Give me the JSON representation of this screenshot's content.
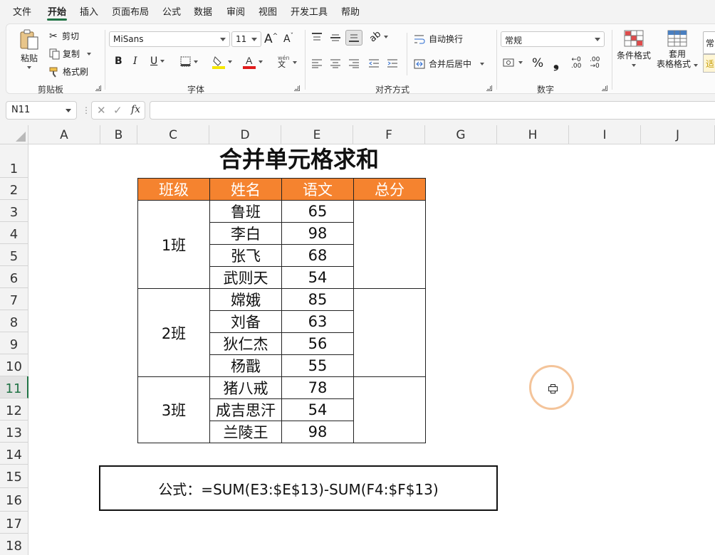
{
  "menu": {
    "file": "文件",
    "home": "开始",
    "insert": "插入",
    "page_layout": "页面布局",
    "formulas": "公式",
    "data": "数据",
    "review": "审阅",
    "view": "视图",
    "developer": "开发工具",
    "help": "帮助"
  },
  "ribbon": {
    "clipboard": {
      "paste": "粘贴",
      "cut": "剪切",
      "copy": "复制",
      "format_painter": "格式刷",
      "label": "剪贴板"
    },
    "font": {
      "family": "MiSans",
      "size": "11",
      "grow": "A",
      "shrink": "A",
      "bold": "B",
      "italic": "I",
      "underline": "U",
      "color_letter": "A",
      "phonetic": "wén",
      "label": "字体"
    },
    "alignment": {
      "wrap_text": "自动换行",
      "merge_center": "合并后居中",
      "label": "对齐方式"
    },
    "number": {
      "format": "常规",
      "percent": "%",
      "comma": "❟",
      "label": "数字"
    },
    "styles": {
      "conditional": "条件格式",
      "format_as_table_1": "套用",
      "format_as_table_2": "表格格式",
      "cell_styles": "常",
      "cell_styles_2": "适"
    },
    "colors": {
      "fill": "#f5e600",
      "font": "#e01b1b"
    }
  },
  "formula_bar": {
    "name_box": "N11",
    "fx": "fx",
    "cancel": "✕",
    "enter": "✓",
    "more": "⋮",
    "value": ""
  },
  "grid": {
    "columns": [
      "A",
      "B",
      "C",
      "D",
      "E",
      "F",
      "G",
      "H",
      "I",
      "J"
    ],
    "rows": [
      "1",
      "2",
      "3",
      "4",
      "5",
      "6",
      "7",
      "8",
      "9",
      "10",
      "11",
      "12",
      "13",
      "14",
      "15",
      "16",
      "17",
      "18"
    ],
    "active_row": "11"
  },
  "sheet": {
    "title": "合并单元格求和",
    "headers": [
      "班级",
      "姓名",
      "语文",
      "总分"
    ],
    "groups": [
      {
        "class": "1班",
        "students": [
          {
            "name": "鲁班",
            "score": "65"
          },
          {
            "name": "李白",
            "score": "98"
          },
          {
            "name": "张飞",
            "score": "68"
          },
          {
            "name": "武则天",
            "score": "54"
          }
        ]
      },
      {
        "class": "2班",
        "students": [
          {
            "name": "嫦娥",
            "score": "85"
          },
          {
            "name": "刘备",
            "score": "63"
          },
          {
            "name": "狄仁杰",
            "score": "56"
          },
          {
            "name": "杨戬",
            "score": "55"
          }
        ]
      },
      {
        "class": "3班",
        "students": [
          {
            "name": "猪八戒",
            "score": "78"
          },
          {
            "name": "成吉思汗",
            "score": "54"
          },
          {
            "name": "兰陵王",
            "score": "98"
          }
        ]
      }
    ],
    "formula_note": "公式：=SUM(E3:$E$13)-SUM(F4:$F$13)",
    "header_color": "#f5832f"
  }
}
